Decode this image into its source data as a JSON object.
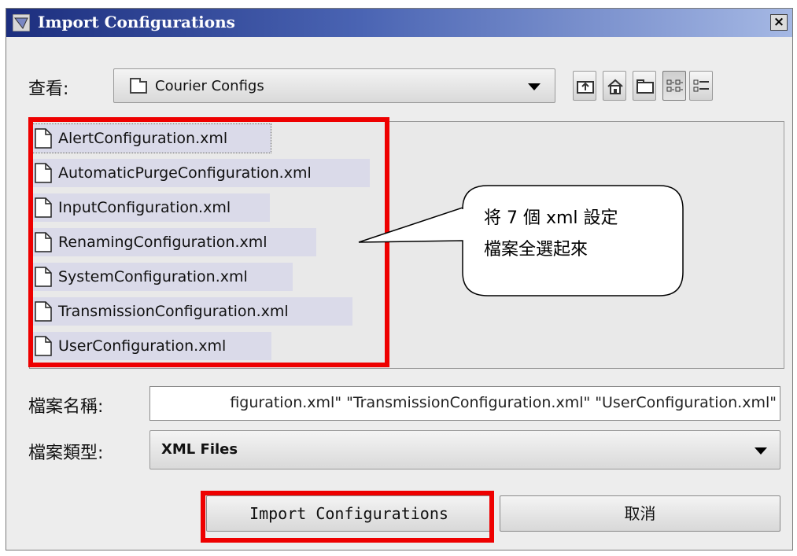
{
  "window": {
    "title": "Import Configurations",
    "close_label": "×"
  },
  "look_in": {
    "label": "查看:",
    "value": "Courier Configs"
  },
  "toolbar": {
    "buttons": [
      "up-folder-icon",
      "home-icon",
      "new-folder-icon",
      "list-view-icon",
      "details-view-icon"
    ]
  },
  "files": [
    "AlertConfiguration.xml",
    "AutomaticPurgeConfiguration.xml",
    "InputConfiguration.xml",
    "RenamingConfiguration.xml",
    "SystemConfiguration.xml",
    "TransmissionConfiguration.xml",
    "UserConfiguration.xml"
  ],
  "callout": {
    "line1": "将 7 個 xml 設定",
    "line2": "檔案全選起來"
  },
  "file_name": {
    "label": "檔案名稱:",
    "value": "figuration.xml\" \"TransmissionConfiguration.xml\" \"UserConfiguration.xml\""
  },
  "file_type": {
    "label": "檔案類型:",
    "value": "XML Files"
  },
  "buttons": {
    "import": "Import Configurations",
    "cancel": "取消"
  },
  "colors": {
    "highlight": "#ee0000",
    "title_start": "#1c2e7e",
    "selection": "#dadae9"
  }
}
